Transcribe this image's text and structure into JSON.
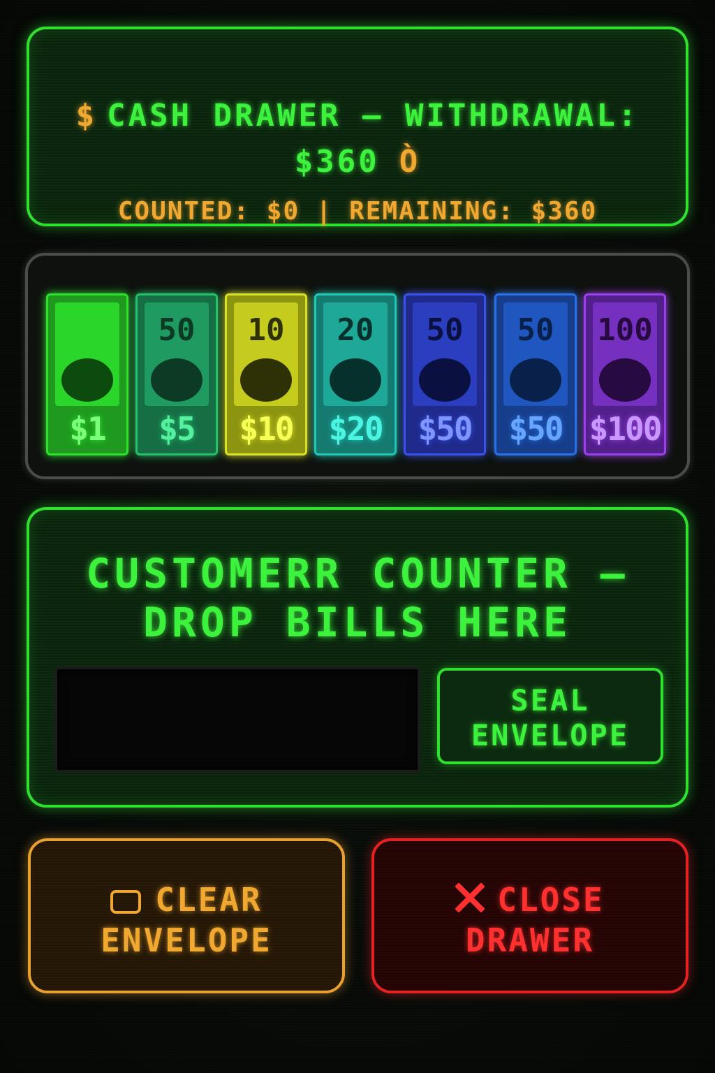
{
  "header": {
    "currency_icon": "$",
    "title": "CASH DRAWER – WITHDRAWAL:",
    "amount": "$360",
    "coin_icon": "Ò",
    "status": "COUNTED: $0 | REMAINING: $360"
  },
  "bills": [
    {
      "value_label": "$1",
      "face_label": "",
      "border": "#2fe02f",
      "fill": "#1f9a1f",
      "inner": "#2bd62b",
      "text": "#7dff7d",
      "denom_color": "#0d4a0d"
    },
    {
      "value_label": "$5",
      "face_label": "50",
      "border": "#25c06a",
      "fill": "#166e45",
      "inner": "#1f9a60",
      "text": "#55f0a0",
      "denom_color": "#0c3a25"
    },
    {
      "value_label": "$10",
      "face_label": "10",
      "border": "#d8e02a",
      "fill": "#8c9410",
      "inner": "#c6cc1e",
      "text": "#f5ff58",
      "denom_color": "#2e3005"
    },
    {
      "value_label": "$20",
      "face_label": "20",
      "border": "#22c8b4",
      "fill": "#157a70",
      "inner": "#1ea898",
      "text": "#4cf4e2",
      "denom_color": "#06302b"
    },
    {
      "value_label": "$50",
      "face_label": "50",
      "border": "#3a52e8",
      "fill": "#1f2a8a",
      "inner": "#2b3ec0",
      "text": "#7f95ff",
      "denom_color": "#0a1040"
    },
    {
      "value_label": "$50",
      "face_label": "50",
      "border": "#2a70e8",
      "fill": "#163e8a",
      "inner": "#1f56c0",
      "text": "#66a6ff",
      "denom_color": "#08204a"
    },
    {
      "value_label": "$100",
      "face_label": "100",
      "border": "#9a40e8",
      "fill": "#52208a",
      "inner": "#7530c0",
      "text": "#c898ff",
      "denom_color": "#260a40"
    }
  ],
  "counter": {
    "title_line1": "CUSTOMERR COUNTER –",
    "title_line2": "DROP BILLS HERE",
    "seal_line1": "SEAL",
    "seal_line2": "ENVELOPE"
  },
  "actions": {
    "clear_line1": "CLEAR",
    "clear_line2": "ENVELOPE",
    "close_line1": "CLOSE",
    "close_line2": "DRAWER"
  },
  "colors": {
    "primary_green": "#2fe02f",
    "amber": "#f0a830",
    "red": "#e52222"
  }
}
